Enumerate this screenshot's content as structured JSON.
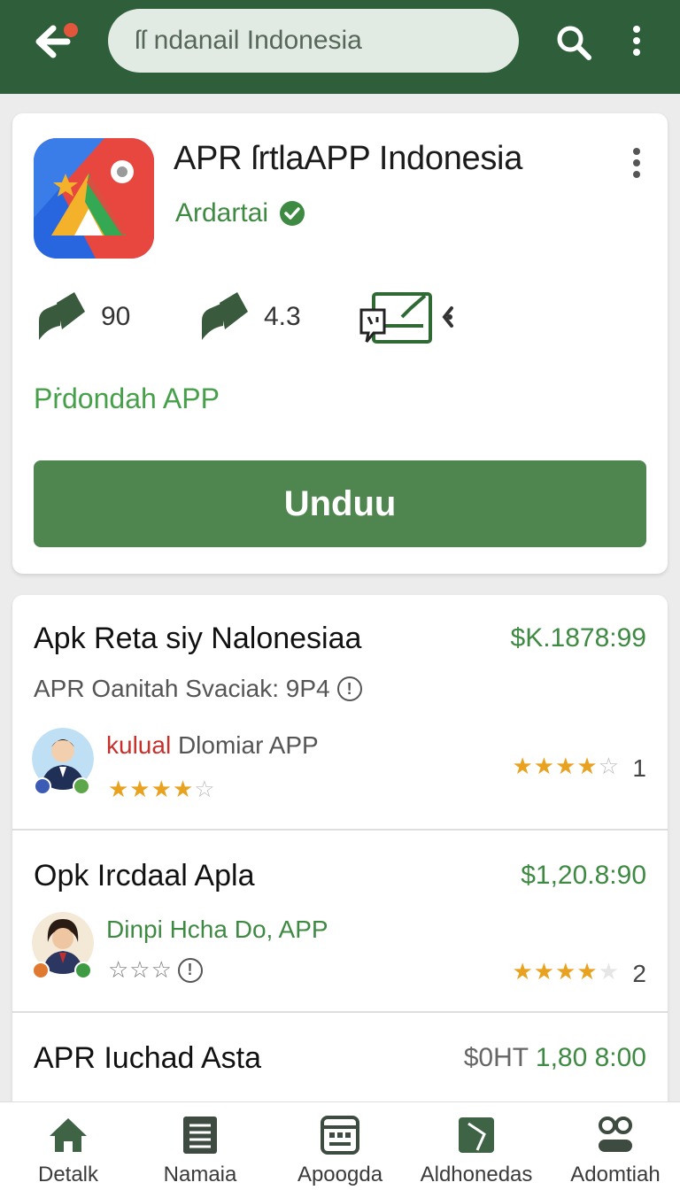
{
  "topbar": {
    "search_text": "ſſ ndanail Indonesia",
    "colors": {
      "bar": "#2f5f3a",
      "notification": "#e2573b"
    }
  },
  "app": {
    "title": "APR ſrtlaAPP Indonesia",
    "developer": "Ardartai",
    "stats": [
      {
        "icon": "rating-icon",
        "value": "90"
      },
      {
        "icon": "rating-icon",
        "value": "4.3"
      },
      {
        "icon": "content-rating-icon",
        "value": ""
      }
    ],
    "install_label": "Pṙdondah APP",
    "download_label": "Unduu",
    "accent": "#4f8650"
  },
  "list": {
    "items": [
      {
        "title": "Apk Reta siy Nalonesiaa",
        "price": "$K.1878:99",
        "subtitle": "APR Oanitah Svaciak: 9P4",
        "reviewer_prefix": "kulual",
        "reviewer_rest": " Dlomiar APP",
        "reviewer_rating": 4.5,
        "reviewer_stars": "★★★★",
        "reviewer_star_half": "☆",
        "rating": 4.5,
        "rating_stars": "★★★★",
        "rating_star_half": "☆",
        "count": "1"
      },
      {
        "title": "Opk Ircdaal Apla",
        "price": "$1,20.8:90",
        "reviewer": "Dinpi Hcha Do, APP",
        "reviewer_stars_empty": "☆☆☆",
        "rating": 4,
        "rating_stars": "★★★★",
        "rating_star_empty": "★",
        "count": "2"
      },
      {
        "title": "APR Iuchad Asta",
        "price_muted": "$0HT",
        "price": " 1,80 8:00"
      }
    ]
  },
  "nav": {
    "items": [
      {
        "label": "Detalk",
        "icon": "home-icon"
      },
      {
        "label": "Namaia",
        "icon": "list-icon"
      },
      {
        "label": "Apoogda",
        "icon": "calendar-icon"
      },
      {
        "label": "Aldhonedas",
        "icon": "book-icon"
      },
      {
        "label": "Adomtiah",
        "icon": "profile-icon"
      }
    ]
  }
}
